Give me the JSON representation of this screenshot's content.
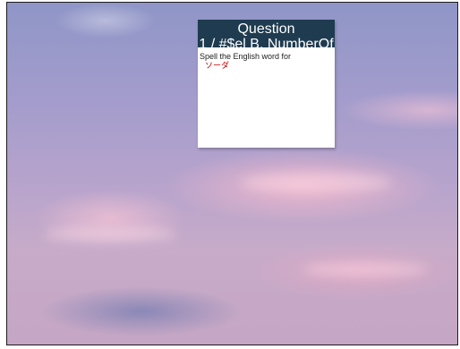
{
  "dialog": {
    "title": "Question",
    "subtitle": "1 / #$el B. NumberOf",
    "prompt": "Spell the English word for",
    "word": "ソーダ"
  },
  "colors": {
    "header_bg": "#1f3b4f",
    "word_color": "#c00000",
    "sky_top": "#8f96c7",
    "sky_bottom": "#c5a6c4"
  }
}
